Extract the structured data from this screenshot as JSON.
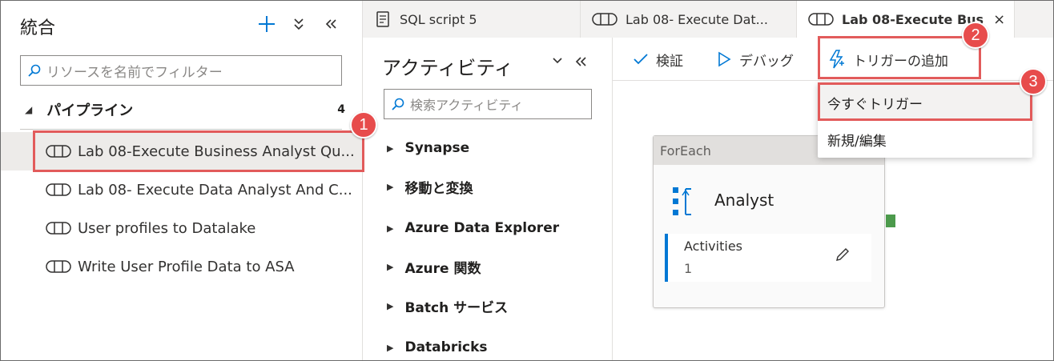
{
  "left_panel": {
    "title": "統合",
    "filter_placeholder": "リソースを名前でフィルター",
    "section": {
      "label": "パイプライン",
      "count": "4"
    },
    "pipelines": [
      "Lab 08-Execute Business Analyst Qu...",
      "Lab 08- Execute Data Analyst And C...",
      "User profiles to Datalake",
      "Write User Profile Data to ASA"
    ]
  },
  "tabs": [
    {
      "label": "SQL script 5"
    },
    {
      "label": "Lab 08- Execute Dat..."
    },
    {
      "label": "Lab 08-Execute Bus"
    }
  ],
  "activities": {
    "title": "アクティビティ",
    "search_placeholder": "検索アクティビティ",
    "categories": [
      "Synapse",
      "移動と変換",
      "Azure Data Explorer",
      "Azure 関数",
      "Batch サービス",
      "Databricks"
    ]
  },
  "toolbar": {
    "validate": "検証",
    "debug": "デバッグ",
    "add_trigger": "トリガーの追加"
  },
  "trigger_menu": {
    "trigger_now": "今すぐトリガー",
    "new_edit": "新規/編集"
  },
  "canvas": {
    "card_type": "ForEach",
    "card_name": "Analyst",
    "activities_label": "Activities",
    "activities_count": "1"
  },
  "callouts": [
    "1",
    "2",
    "3"
  ],
  "colors": {
    "accent": "#0078d4",
    "callout": "#e74c4c",
    "selected_bg": "#edebe9"
  }
}
